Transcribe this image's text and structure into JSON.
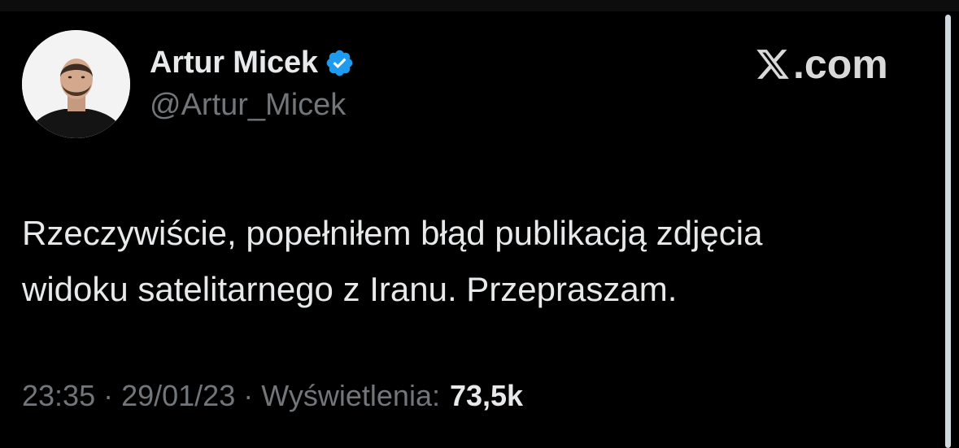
{
  "author": {
    "display_name": "Artur Micek",
    "handle": "@Artur_Micek",
    "verified": true,
    "verified_badge_color": "#1d9bf0"
  },
  "brand": {
    "icon": "x-logo-icon",
    "label": ".com"
  },
  "tweet": {
    "lines": [
      "Rzeczywiście, popełniłem błąd publikacją zdjęcia",
      "widoku satelitarnego z Iranu. Przepraszam."
    ]
  },
  "meta": {
    "time": "23:35",
    "separator": "·",
    "date": "29/01/23",
    "views_label": "Wyświetlenia:",
    "views_count": "73,5k"
  },
  "colors": {
    "background": "#000000",
    "primary_text": "#e7e9ea",
    "secondary_text": "#71767b"
  }
}
